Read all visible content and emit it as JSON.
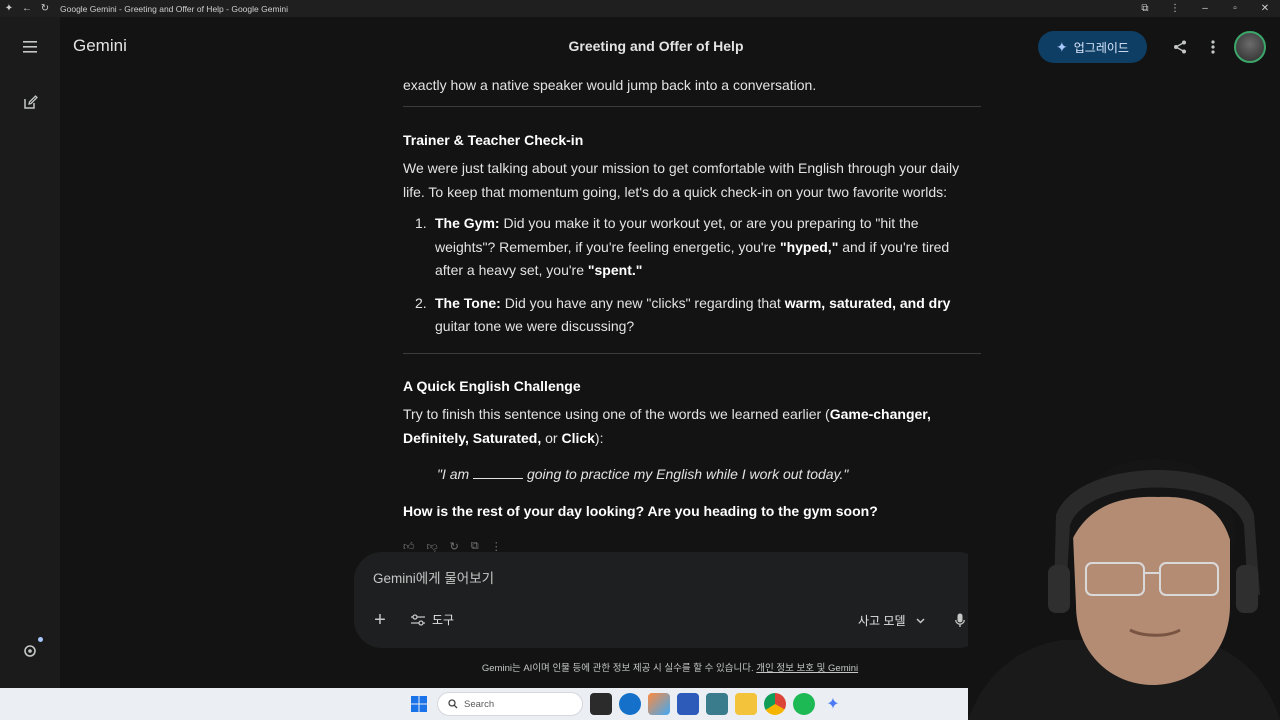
{
  "browser": {
    "tab_title": "Google Gemini - Greeting and Offer of Help - Google Gemini"
  },
  "header": {
    "brand": "Gemini",
    "conversation_title": "Greeting and Offer of Help",
    "upgrade_label": "업그레이드"
  },
  "message": {
    "intro_tail": "exactly how a native speaker would jump back into a conversation.",
    "section1": {
      "title": "Trainer & Teacher Check-in",
      "body": "We were just talking about your mission to get comfortable with English through your daily life. To keep that momentum going, let's do a quick check-in on your two favorite worlds:",
      "items": [
        {
          "num": "1.",
          "lead": "The Gym:",
          "t1": " Did you make it to your workout yet, or are you preparing to \"hit the weights\"? Remember, if you're feeling energetic, you're ",
          "b1": "\"hyped,\"",
          "t2": " and if you're tired after a heavy set, you're ",
          "b2": "\"spent.\"",
          "t3": ""
        },
        {
          "num": "2.",
          "lead": "The Tone:",
          "t1": " Did you have any new \"clicks\" regarding that ",
          "b1": "warm, saturated, and dry",
          "t2": " guitar tone we were discussing?",
          "b2": "",
          "t3": ""
        }
      ]
    },
    "section2": {
      "title": "A Quick English Challenge",
      "body_pre": "Try to finish this sentence using one of the words we learned earlier (",
      "words": "Game-changer, Definitely, Saturated,",
      "or": " or ",
      "last_word": "Click",
      "body_post": "):",
      "quote_pre": "\"I am ",
      "quote_post": " going to practice my English while I work out today.\""
    },
    "closing": "How is the rest of your day looking? Are you heading to the gym soon?"
  },
  "prompt": {
    "placeholder": "Gemini에게 물어보기",
    "tools_label": "도구",
    "model_label": "사고 모델"
  },
  "footer": {
    "disclaimer": "Gemini는 AI이며 인물 등에 관한 정보 제공 시 실수를 할 수 있습니다. ",
    "privacy_link": "개인 정보 보호 및 Gemini"
  },
  "taskbar": {
    "search_label": "Search"
  },
  "colors": {
    "background": "#131314",
    "upgrade_bg": "#0e3e63",
    "accent": "#a8c7fa"
  }
}
